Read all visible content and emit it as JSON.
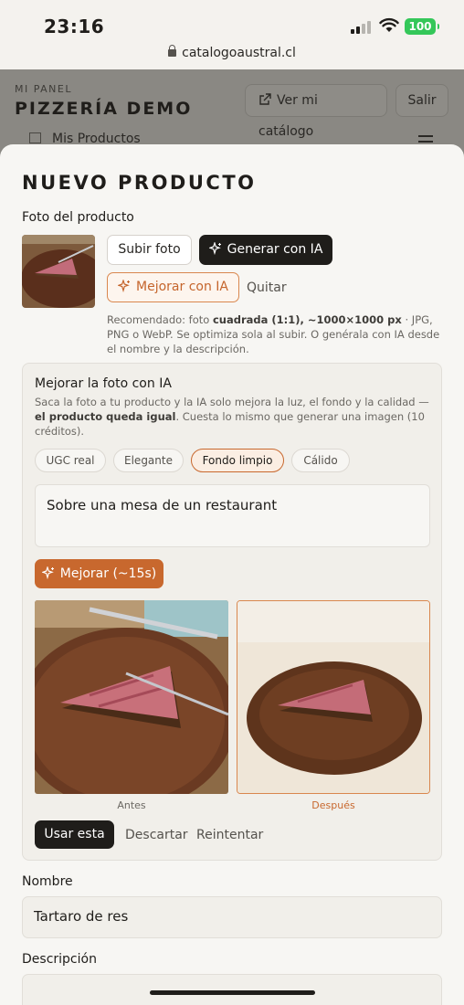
{
  "status_bar": {
    "time": "23:16",
    "battery": "100",
    "url": "catalogoaustral.cl"
  },
  "header": {
    "eyebrow": "MI PANEL",
    "title": "PIZZERÍA DEMO",
    "catalog_button": "Ver mi catálogo",
    "logout_button": "Salir",
    "section": "Mis Productos"
  },
  "sheet": {
    "title": "NUEVO PRODUCTO",
    "photo_label": "Foto del producto",
    "upload_button": "Subir foto",
    "generate_button": "Generar con IA",
    "improve_button": "Mejorar con IA",
    "remove_link": "Quitar",
    "hint_prefix": "Recomendado: foto ",
    "hint_bold": "cuadrada (1:1), ~1000×1000 px",
    "hint_suffix": " · JPG, PNG o WebP. Se optimiza sola al subir. O genérala con IA desde el nombre y la descripción."
  },
  "ai_panel": {
    "title": "Mejorar la foto con IA",
    "desc_prefix": "Saca la foto a tu producto y la IA solo mejora la luz, el fondo y la calidad — ",
    "desc_bold": "el producto queda igual",
    "desc_suffix": ". Cuesta lo mismo que generar una imagen (10 créditos).",
    "styles": [
      {
        "label": "UGC real",
        "selected": false
      },
      {
        "label": "Elegante",
        "selected": false
      },
      {
        "label": "Fondo limpio",
        "selected": true
      },
      {
        "label": "Cálido",
        "selected": false
      }
    ],
    "prompt_value": "Sobre una mesa de un restaurant",
    "improve_button": "Mejorar (~15s)",
    "before_caption": "Antes",
    "after_caption": "Después",
    "use_button": "Usar esta",
    "discard_link": "Descartar",
    "retry_link": "Reintentar"
  },
  "form": {
    "name_label": "Nombre",
    "name_value": "Tartaro de res",
    "description_label": "Descripción"
  },
  "colors": {
    "accent": "#c8682e",
    "dark": "#1f1d1a",
    "sheet_bg": "#f7f6f3"
  }
}
